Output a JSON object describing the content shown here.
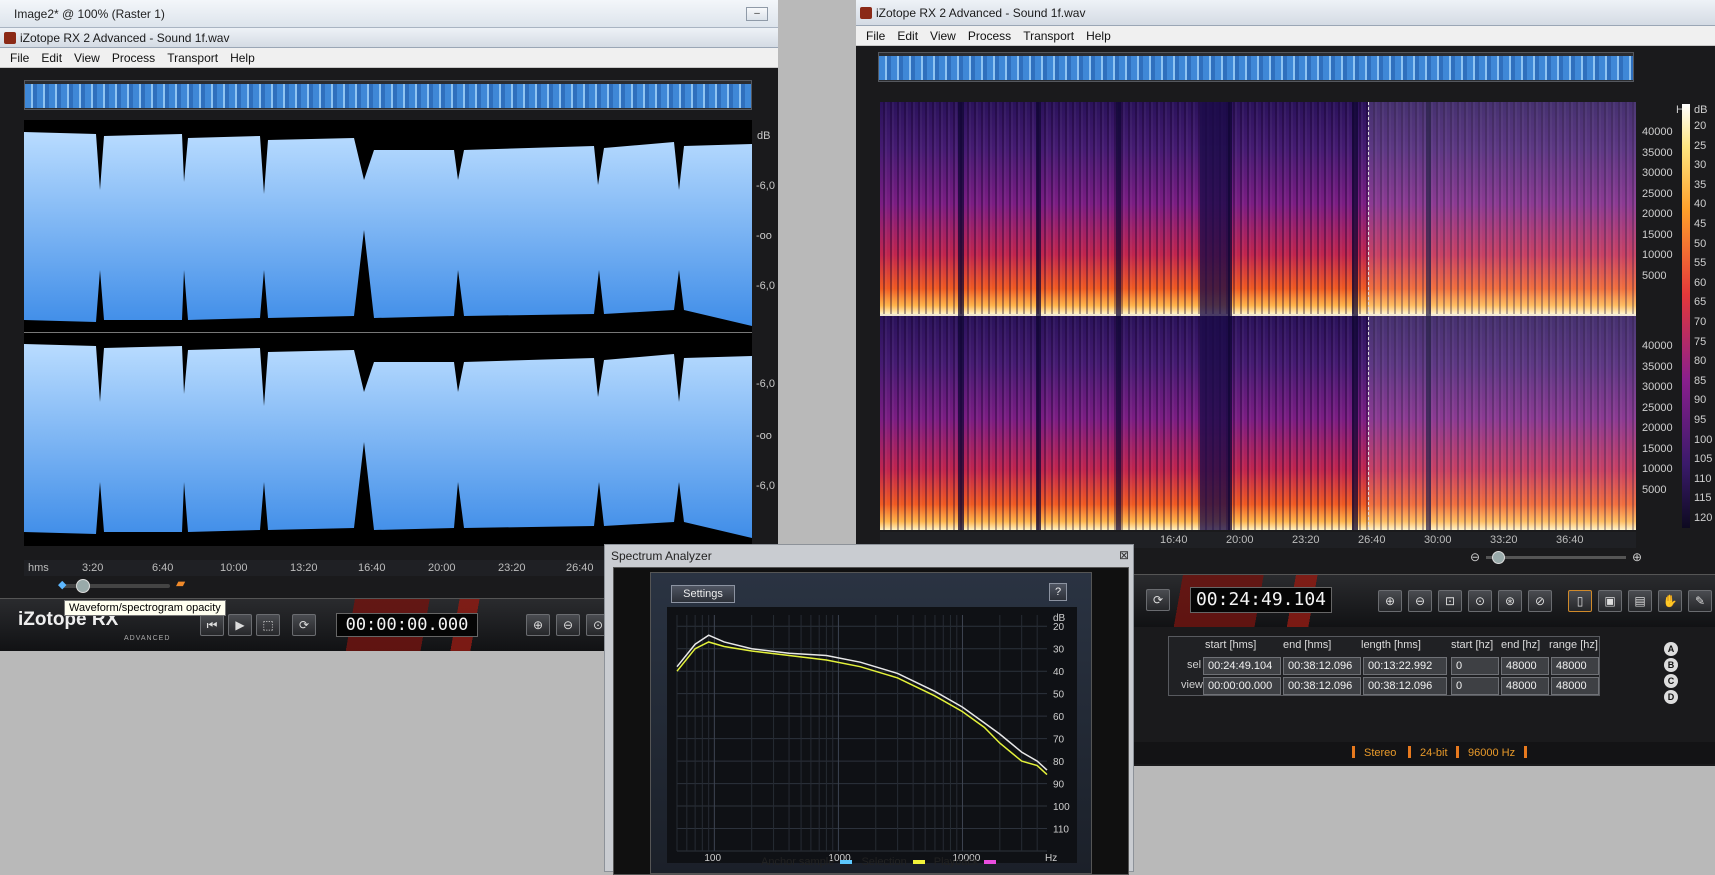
{
  "raster_window": {
    "title": "Image2* @ 100% (Raster 1)",
    "minimize": "–"
  },
  "left_app": {
    "title": "iZotope RX 2 Advanced - Sound 1f.wav",
    "menu": [
      "File",
      "Edit",
      "View",
      "Process",
      "Transport",
      "Help"
    ],
    "db_scale": [
      "dB",
      "-6,0",
      "-oo",
      "-6,0",
      "-6,0",
      "-oo",
      "-6,0"
    ],
    "time_axis": [
      "hms",
      "3:20",
      "6:40",
      "10:00",
      "13:20",
      "16:40",
      "20:00",
      "23:20",
      "26:40"
    ],
    "tooltip": "Waveform/spectrogram opacity",
    "time_display": "00:00:00.000",
    "logo": "iZotope RX",
    "logo_sub": "ADVANCED"
  },
  "right_app": {
    "title": "iZotope RX 2 Advanced - Sound 1f.wav",
    "menu": [
      "File",
      "Edit",
      "View",
      "Process",
      "Transport",
      "Help"
    ],
    "hz_scale": [
      "Hz",
      "40000",
      "35000",
      "30000",
      "25000",
      "20000",
      "15000",
      "10000",
      "5000",
      "40000",
      "35000",
      "30000",
      "25000",
      "20000",
      "15000",
      "10000",
      "5000"
    ],
    "db_scale": [
      "dB",
      "20",
      "25",
      "30",
      "35",
      "40",
      "45",
      "50",
      "55",
      "60",
      "65",
      "70",
      "75",
      "80",
      "85",
      "90",
      "95",
      "100",
      "105",
      "110",
      "115",
      "120"
    ],
    "time_axis": [
      "16:40",
      "20:00",
      "23:20",
      "26:40",
      "30:00",
      "33:20",
      "36:40"
    ],
    "time_display": "00:24:49.104",
    "selection_table": {
      "headers": [
        "start [hms]",
        "end [hms]",
        "length [hms]",
        "start [hz]",
        "end [hz]",
        "range [hz]"
      ],
      "rows": [
        {
          "label": "sel",
          "cells": [
            "00:24:49.104",
            "00:38:12.096",
            "00:13:22.992",
            "0",
            "48000",
            "48000"
          ]
        },
        {
          "label": "view",
          "cells": [
            "00:00:00.000",
            "00:38:12.096",
            "00:38:12.096",
            "0",
            "48000",
            "48000"
          ]
        }
      ]
    },
    "abcd": [
      "A",
      "B",
      "C",
      "D"
    ],
    "status": [
      "Stereo",
      "24-bit",
      "96000 Hz"
    ]
  },
  "spectrum_analyzer": {
    "title": "Spectrum Analyzer",
    "settings_label": "Settings",
    "help_label": "?",
    "close": "⊠",
    "db_axis": [
      "dB",
      "20",
      "30",
      "40",
      "50",
      "60",
      "70",
      "80",
      "90",
      "100",
      "110"
    ],
    "freq_axis": [
      "100",
      "1000",
      "10000",
      "Hz"
    ],
    "legend": [
      {
        "label": "Anchor sample",
        "color": "#5cc8ff"
      },
      {
        "label": "Selection",
        "color": "#f2f23a"
      },
      {
        "label": "Playback",
        "color": "#e94de0"
      }
    ],
    "chart_data": {
      "type": "line",
      "x_scale": "log",
      "series": [
        {
          "color": "#e8e8e8",
          "x": [
            50,
            70,
            90,
            120,
            200,
            400,
            800,
            1500,
            3000,
            6000,
            10000,
            15000,
            20000,
            30000,
            40000,
            48000
          ],
          "y": [
            38,
            28,
            24,
            27,
            30,
            32,
            33,
            36,
            41,
            49,
            56,
            63,
            68,
            76,
            80,
            84
          ]
        },
        {
          "color": "#e4f23a",
          "x": [
            50,
            70,
            90,
            120,
            200,
            400,
            800,
            1500,
            3000,
            6000,
            10000,
            15000,
            20000,
            30000,
            40000,
            48000
          ],
          "y": [
            40,
            30,
            27,
            29,
            31,
            33,
            35,
            38,
            43,
            51,
            58,
            65,
            72,
            80,
            82,
            86
          ]
        }
      ],
      "ylim": [
        15,
        120
      ],
      "xlim": [
        50,
        48000
      ]
    }
  }
}
